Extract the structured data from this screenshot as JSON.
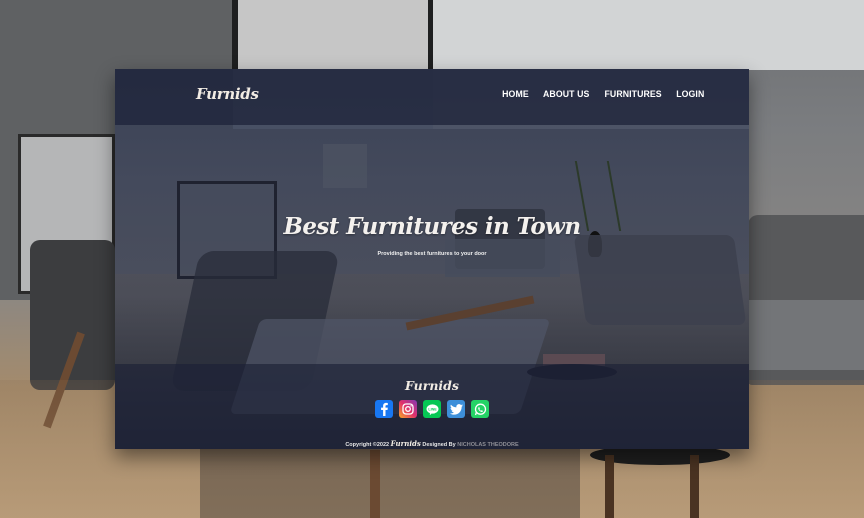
{
  "brand": "Furnids",
  "nav": {
    "items": [
      {
        "label": "HOME"
      },
      {
        "label": "ABOUT US"
      },
      {
        "label": "FURNITURES"
      },
      {
        "label": "LOGIN"
      }
    ]
  },
  "hero": {
    "title": "Best Furnitures in Town",
    "subtitle": "Providing the best furnitures to your door"
  },
  "footer": {
    "brand": "Furnids",
    "socials": [
      {
        "name": "facebook-icon",
        "color": "#1877f2"
      },
      {
        "name": "instagram-icon",
        "color": "#d6249f"
      },
      {
        "name": "line-icon",
        "color": "#06c755"
      },
      {
        "name": "twitter-icon",
        "color": "#1da1f2"
      },
      {
        "name": "whatsapp-icon",
        "color": "#25d366"
      }
    ],
    "copyright_prefix": "Copyright ©2022",
    "copyright_brand": "Furnids",
    "designed_by": "Designed By",
    "author": "NICHOLAS THEODORE"
  }
}
